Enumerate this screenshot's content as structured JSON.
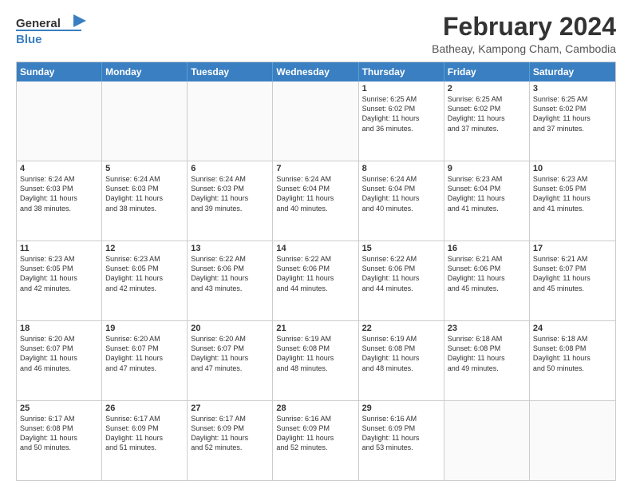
{
  "header": {
    "logo_general": "General",
    "logo_blue": "Blue",
    "title": "February 2024",
    "subtitle": "Batheay, Kampong Cham, Cambodia"
  },
  "days": [
    "Sunday",
    "Monday",
    "Tuesday",
    "Wednesday",
    "Thursday",
    "Friday",
    "Saturday"
  ],
  "weeks": [
    [
      {
        "num": "",
        "detail": ""
      },
      {
        "num": "",
        "detail": ""
      },
      {
        "num": "",
        "detail": ""
      },
      {
        "num": "",
        "detail": ""
      },
      {
        "num": "1",
        "detail": "Sunrise: 6:25 AM\nSunset: 6:02 PM\nDaylight: 11 hours\nand 36 minutes."
      },
      {
        "num": "2",
        "detail": "Sunrise: 6:25 AM\nSunset: 6:02 PM\nDaylight: 11 hours\nand 37 minutes."
      },
      {
        "num": "3",
        "detail": "Sunrise: 6:25 AM\nSunset: 6:02 PM\nDaylight: 11 hours\nand 37 minutes."
      }
    ],
    [
      {
        "num": "4",
        "detail": "Sunrise: 6:24 AM\nSunset: 6:03 PM\nDaylight: 11 hours\nand 38 minutes."
      },
      {
        "num": "5",
        "detail": "Sunrise: 6:24 AM\nSunset: 6:03 PM\nDaylight: 11 hours\nand 38 minutes."
      },
      {
        "num": "6",
        "detail": "Sunrise: 6:24 AM\nSunset: 6:03 PM\nDaylight: 11 hours\nand 39 minutes."
      },
      {
        "num": "7",
        "detail": "Sunrise: 6:24 AM\nSunset: 6:04 PM\nDaylight: 11 hours\nand 40 minutes."
      },
      {
        "num": "8",
        "detail": "Sunrise: 6:24 AM\nSunset: 6:04 PM\nDaylight: 11 hours\nand 40 minutes."
      },
      {
        "num": "9",
        "detail": "Sunrise: 6:23 AM\nSunset: 6:04 PM\nDaylight: 11 hours\nand 41 minutes."
      },
      {
        "num": "10",
        "detail": "Sunrise: 6:23 AM\nSunset: 6:05 PM\nDaylight: 11 hours\nand 41 minutes."
      }
    ],
    [
      {
        "num": "11",
        "detail": "Sunrise: 6:23 AM\nSunset: 6:05 PM\nDaylight: 11 hours\nand 42 minutes."
      },
      {
        "num": "12",
        "detail": "Sunrise: 6:23 AM\nSunset: 6:05 PM\nDaylight: 11 hours\nand 42 minutes."
      },
      {
        "num": "13",
        "detail": "Sunrise: 6:22 AM\nSunset: 6:06 PM\nDaylight: 11 hours\nand 43 minutes."
      },
      {
        "num": "14",
        "detail": "Sunrise: 6:22 AM\nSunset: 6:06 PM\nDaylight: 11 hours\nand 44 minutes."
      },
      {
        "num": "15",
        "detail": "Sunrise: 6:22 AM\nSunset: 6:06 PM\nDaylight: 11 hours\nand 44 minutes."
      },
      {
        "num": "16",
        "detail": "Sunrise: 6:21 AM\nSunset: 6:06 PM\nDaylight: 11 hours\nand 45 minutes."
      },
      {
        "num": "17",
        "detail": "Sunrise: 6:21 AM\nSunset: 6:07 PM\nDaylight: 11 hours\nand 45 minutes."
      }
    ],
    [
      {
        "num": "18",
        "detail": "Sunrise: 6:20 AM\nSunset: 6:07 PM\nDaylight: 11 hours\nand 46 minutes."
      },
      {
        "num": "19",
        "detail": "Sunrise: 6:20 AM\nSunset: 6:07 PM\nDaylight: 11 hours\nand 47 minutes."
      },
      {
        "num": "20",
        "detail": "Sunrise: 6:20 AM\nSunset: 6:07 PM\nDaylight: 11 hours\nand 47 minutes."
      },
      {
        "num": "21",
        "detail": "Sunrise: 6:19 AM\nSunset: 6:08 PM\nDaylight: 11 hours\nand 48 minutes."
      },
      {
        "num": "22",
        "detail": "Sunrise: 6:19 AM\nSunset: 6:08 PM\nDaylight: 11 hours\nand 48 minutes."
      },
      {
        "num": "23",
        "detail": "Sunrise: 6:18 AM\nSunset: 6:08 PM\nDaylight: 11 hours\nand 49 minutes."
      },
      {
        "num": "24",
        "detail": "Sunrise: 6:18 AM\nSunset: 6:08 PM\nDaylight: 11 hours\nand 50 minutes."
      }
    ],
    [
      {
        "num": "25",
        "detail": "Sunrise: 6:17 AM\nSunset: 6:08 PM\nDaylight: 11 hours\nand 50 minutes."
      },
      {
        "num": "26",
        "detail": "Sunrise: 6:17 AM\nSunset: 6:09 PM\nDaylight: 11 hours\nand 51 minutes."
      },
      {
        "num": "27",
        "detail": "Sunrise: 6:17 AM\nSunset: 6:09 PM\nDaylight: 11 hours\nand 52 minutes."
      },
      {
        "num": "28",
        "detail": "Sunrise: 6:16 AM\nSunset: 6:09 PM\nDaylight: 11 hours\nand 52 minutes."
      },
      {
        "num": "29",
        "detail": "Sunrise: 6:16 AM\nSunset: 6:09 PM\nDaylight: 11 hours\nand 53 minutes."
      },
      {
        "num": "",
        "detail": ""
      },
      {
        "num": "",
        "detail": ""
      }
    ]
  ]
}
